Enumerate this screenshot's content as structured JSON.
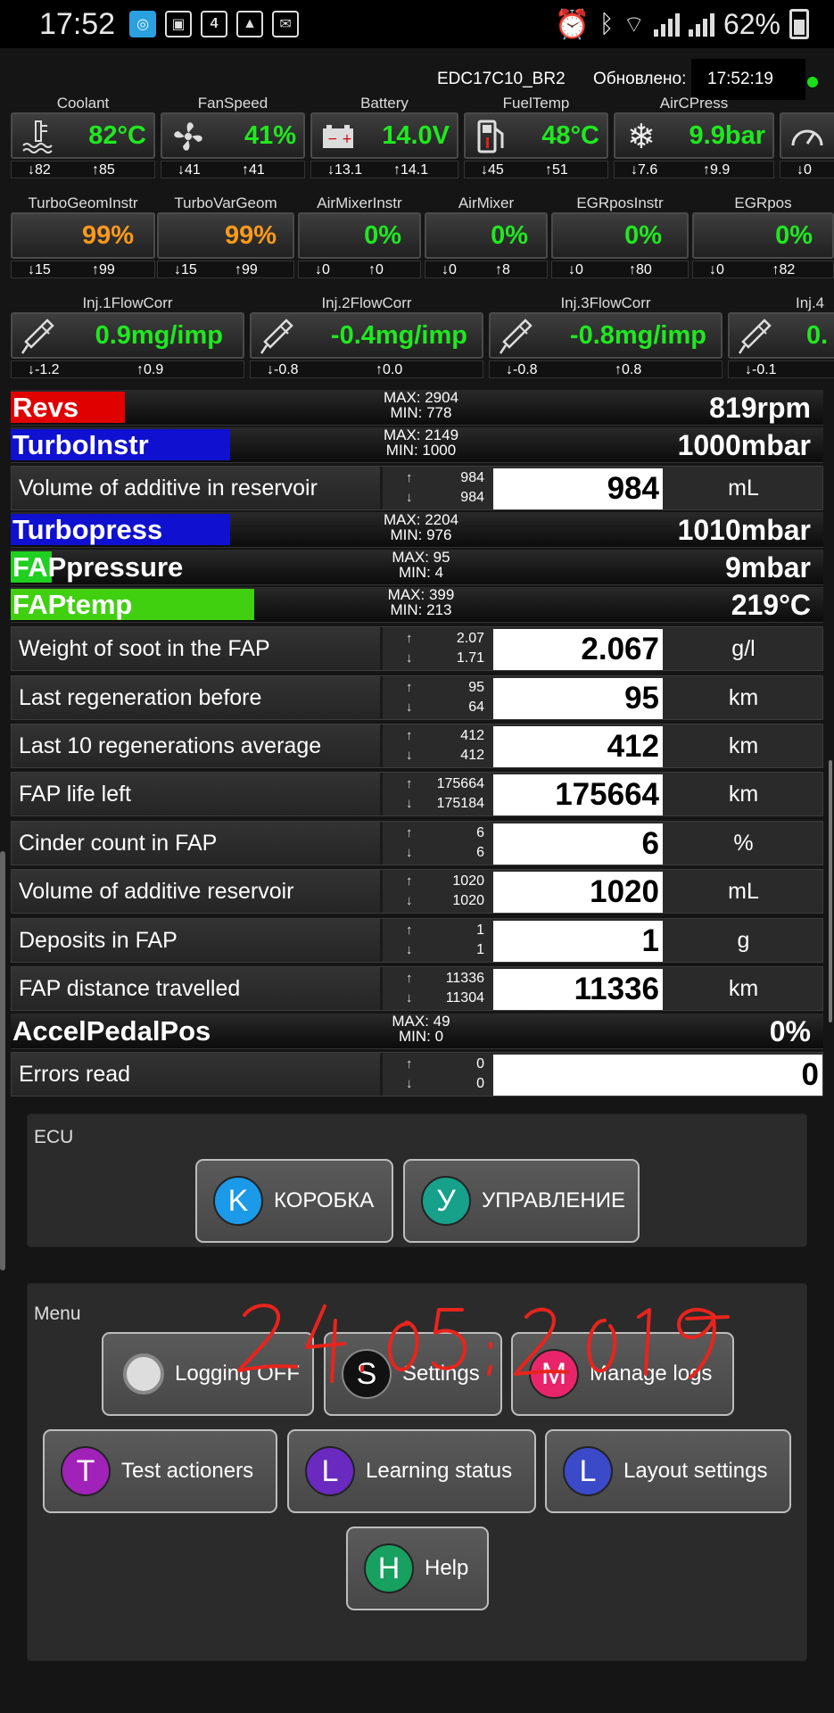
{
  "status_bar": {
    "time": "17:52",
    "battery": "62%"
  },
  "info": {
    "ecu": "EDC17C10_BR2",
    "updated_label": "Обновлено:",
    "updated_time": "17:52:19"
  },
  "gauges_row1": [
    {
      "title": "Coolant",
      "value": "82°C",
      "min": "82",
      "max": "85",
      "icon": "coolant-icon"
    },
    {
      "title": "FanSpeed",
      "value": "41%",
      "min": "41",
      "max": "41",
      "icon": "fan-icon"
    },
    {
      "title": "Battery",
      "value": "14.0V",
      "min": "13.1",
      "max": "14.1",
      "icon": "battery-icon"
    },
    {
      "title": "FuelTemp",
      "value": "48°C",
      "min": "45",
      "max": "51",
      "icon": "fuel-icon"
    },
    {
      "title": "AirCPress",
      "value": "9.9bar",
      "min": "7.6",
      "max": "9.9",
      "icon": "snowflake-icon"
    },
    {
      "title": "",
      "value": "",
      "min": "0",
      "max": "",
      "icon": "gauge-icon"
    }
  ],
  "gauges_row2": [
    {
      "title": "TurboGeomInstr",
      "value": "99%",
      "min": "15",
      "max": "99"
    },
    {
      "title": "TurboVarGeom",
      "value": "99%",
      "min": "15",
      "max": "99"
    },
    {
      "title": "AirMixerInstr",
      "value": "0%",
      "min": "0",
      "max": "0"
    },
    {
      "title": "AirMixer",
      "value": "0%",
      "min": "0",
      "max": "8"
    },
    {
      "title": "EGRposInstr",
      "value": "0%",
      "min": "0",
      "max": "80"
    },
    {
      "title": "EGRpos",
      "value": "0%",
      "min": "0",
      "max": "82"
    }
  ],
  "gauges_row3": [
    {
      "title": "Inj.1FlowCorr",
      "value": "0.9mg/imp",
      "min": "-1.2",
      "max": "0.9"
    },
    {
      "title": "Inj.2FlowCorr",
      "value": "-0.4mg/imp",
      "min": "-0.8",
      "max": "0.0"
    },
    {
      "title": "Inj.3FlowCorr",
      "value": "-0.8mg/imp",
      "min": "-0.8",
      "max": "0.8"
    },
    {
      "title": "Inj.4",
      "value": "0.",
      "min": "-0.1",
      "max": ""
    }
  ],
  "bars": {
    "revs": {
      "label": "Revs",
      "max": "MAX: 2904",
      "min": "MIN: 778",
      "value": "819rpm",
      "level": 0.14,
      "color": "#e00000"
    },
    "turboinstr": {
      "label": "TurboInstr",
      "max": "MAX: 2149",
      "min": "MIN: 1000",
      "value": "1000mbar",
      "level": 0.27,
      "color": "#1010d0"
    },
    "turbopress": {
      "label": "Turbopress",
      "max": "MAX: 2204",
      "min": "MIN: 976",
      "value": "1010mbar",
      "level": 0.27,
      "color": "#1010d0"
    },
    "fappressure": {
      "label": "FAPpressure",
      "max": "MAX: 95",
      "min": "MIN: 4",
      "value": "9mbar",
      "level": 0.05,
      "color": "#20d020"
    },
    "faptemp": {
      "label": "FAPtemp",
      "max": "MAX: 399",
      "min": "MIN: 213",
      "value": "219°C",
      "level": 0.3,
      "color": "#40d010"
    },
    "accel": {
      "label": "AccelPedalPos",
      "max": "MAX: 49",
      "min": "MIN: 0",
      "value": "0%",
      "level": 0.0,
      "color": "#20d020"
    }
  },
  "rows": {
    "vol_add": {
      "label": "Volume of additive in reservoir",
      "up": "984",
      "down": "984",
      "value": "984",
      "unit": "mL"
    },
    "soot": {
      "label": "Weight of soot in the FAP",
      "up": "2.07",
      "down": "1.71",
      "value": "2.067",
      "unit": "g/l"
    },
    "last_regen": {
      "label": "Last regeneration before",
      "up": "95",
      "down": "64",
      "value": "95",
      "unit": "km"
    },
    "last10": {
      "label": "Last 10 regenerations average",
      "up": "412",
      "down": "412",
      "value": "412",
      "unit": "km"
    },
    "life": {
      "label": "FAP life left",
      "up": "175664",
      "down": "175184",
      "value": "175664",
      "unit": "km"
    },
    "cinder": {
      "label": "Cinder count in FAP",
      "up": "6",
      "down": "6",
      "value": "6",
      "unit": "%"
    },
    "vol_res": {
      "label": "Volume of additive reservoir",
      "up": "1020",
      "down": "1020",
      "value": "1020",
      "unit": "mL"
    },
    "deposits": {
      "label": "Deposits in FAP",
      "up": "1",
      "down": "1",
      "value": "1",
      "unit": "g"
    },
    "distance": {
      "label": "FAP distance travelled",
      "up": "11336",
      "down": "11304",
      "value": "11336",
      "unit": "km"
    },
    "errors": {
      "label": "Errors read",
      "up": "0",
      "down": "0",
      "value": "0",
      "unit": ""
    }
  },
  "ecu_panel": {
    "title": "ECU",
    "btn1": {
      "letter": "K",
      "label": "КОРОБКА",
      "color": "#1a9ae8"
    },
    "btn2": {
      "letter": "У",
      "label": "УПРАВЛЕНИЕ",
      "color": "#17a08a"
    }
  },
  "handwritten_date": "24.05.2019",
  "menu_panel": {
    "title": "Menu",
    "logging": {
      "label": "Logging OFF"
    },
    "settings": {
      "letter": "S",
      "label": "Settings",
      "color": "#111111"
    },
    "manage": {
      "letter": "M",
      "label": "Manage logs",
      "color": "#e8256b"
    },
    "test": {
      "letter": "T",
      "label": "Test actioners",
      "color": "#a022b8"
    },
    "learning": {
      "letter": "L",
      "label": "Learning status",
      "color": "#6a2ac0"
    },
    "layout": {
      "letter": "L",
      "label": "Layout settings",
      "color": "#3a4ac8"
    },
    "help": {
      "letter": "H",
      "label": "Help",
      "color": "#18a060"
    }
  }
}
